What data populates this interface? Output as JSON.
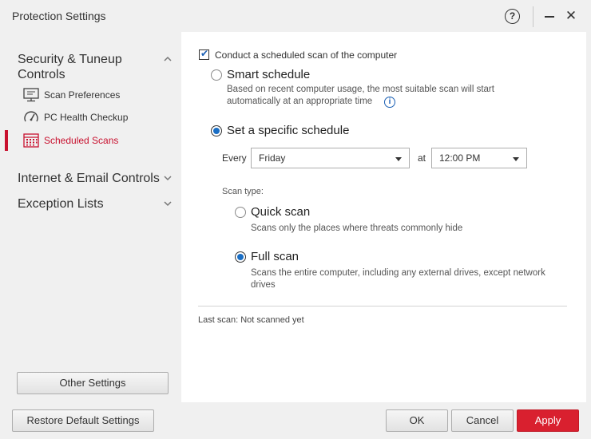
{
  "window": {
    "title": "Protection Settings",
    "help_glyph": "?",
    "close_glyph": "✕"
  },
  "sidebar": {
    "groups": [
      {
        "title": "Security & Tuneup Controls",
        "expanded": true,
        "items": [
          {
            "label": "Scan Preferences",
            "icon": "monitor-icon",
            "active": false
          },
          {
            "label": "PC Health Checkup",
            "icon": "gauge-icon",
            "active": false
          },
          {
            "label": "Scheduled Scans",
            "icon": "calendar-icon",
            "active": true
          }
        ]
      },
      {
        "title": "Internet & Email Controls",
        "expanded": false
      },
      {
        "title": "Exception Lists",
        "expanded": false
      }
    ],
    "other_settings_label": "Other Settings"
  },
  "main": {
    "scheduled_scan_label": "Conduct a scheduled scan of the computer",
    "scheduled_scan_checked": true,
    "smart_schedule": {
      "label": "Smart schedule",
      "selected": false,
      "description": "Based on recent computer usage, the most suitable scan will start automatically at an appropriate time",
      "info_glyph": "i"
    },
    "specific_schedule": {
      "label": "Set a specific schedule",
      "selected": true,
      "every_label": "Every",
      "day_value": "Friday",
      "at_label": "at",
      "time_value": "12:00 PM"
    },
    "scan_type": {
      "label": "Scan type:",
      "options": [
        {
          "label": "Quick scan",
          "description": "Scans only the places where threats commonly hide",
          "selected": false
        },
        {
          "label": "Full scan",
          "description": "Scans the entire computer, including any external drives, except network drives",
          "selected": true
        }
      ]
    },
    "last_scan": "Last scan: Not scanned yet"
  },
  "footer": {
    "restore_label": "Restore Default Settings",
    "ok_label": "OK",
    "cancel_label": "Cancel",
    "apply_label": "Apply"
  },
  "colors": {
    "accent_red": "#c8102e",
    "apply_button": "#d9202f",
    "radio_blue": "#1a6ec4"
  }
}
